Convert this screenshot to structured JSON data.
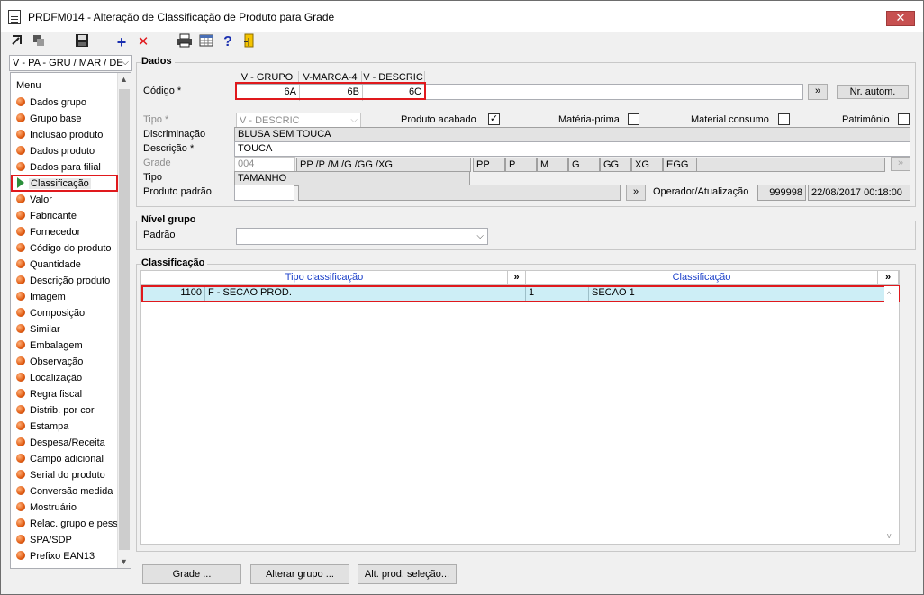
{
  "window": {
    "title": "PRDFM014 - Alteração de Classificação de Produto para Grade",
    "close_icon": "✕"
  },
  "toolbar": {
    "icons": [
      "navigate-icon",
      "copy-icon",
      "save-icon",
      "add-icon",
      "delete-icon",
      "print-icon",
      "grid-icon",
      "help-icon",
      "exit-icon"
    ]
  },
  "sidebar": {
    "combo_value": "V - PA - GRU / MAR / DE",
    "menu_title": "Menu",
    "items": [
      {
        "label": "Dados grupo"
      },
      {
        "label": "Grupo base"
      },
      {
        "label": "Inclusão produto"
      },
      {
        "label": "Dados produto"
      },
      {
        "label": "Dados para filial"
      },
      {
        "label": "Classificação",
        "selected": true
      },
      {
        "label": "Valor"
      },
      {
        "label": "Fabricante"
      },
      {
        "label": "Fornecedor"
      },
      {
        "label": "Código do produto"
      },
      {
        "label": "Quantidade"
      },
      {
        "label": "Descrição produto"
      },
      {
        "label": "Imagem"
      },
      {
        "label": "Composição"
      },
      {
        "label": "Similar"
      },
      {
        "label": "Embalagem"
      },
      {
        "label": "Observação"
      },
      {
        "label": "Localização"
      },
      {
        "label": "Regra fiscal"
      },
      {
        "label": "Distrib. por cor"
      },
      {
        "label": "Estampa"
      },
      {
        "label": "Despesa/Receita"
      },
      {
        "label": "Campo adicional"
      },
      {
        "label": "Serial do produto"
      },
      {
        "label": "Conversão medida"
      },
      {
        "label": "Mostruário"
      },
      {
        "label": "Relac. grupo e pess"
      },
      {
        "label": "SPA/SDP"
      },
      {
        "label": "Prefixo EAN13"
      }
    ]
  },
  "dados": {
    "section_title": "Dados",
    "codigo_label": "Código *",
    "codigo_columns": [
      "V - GRUPO",
      "V-MARCA-4",
      "V - DESCRIC"
    ],
    "codigo_values": [
      "6A",
      "6B",
      "6C"
    ],
    "expand_label": "»",
    "nr_autom_label": "Nr. autom.",
    "tipo_label": "Tipo *",
    "tipo_value": "V - DESCRIC",
    "produto_acabado_label": "Produto acabado",
    "produto_acabado_checked": true,
    "materia_prima_label": "Matéria-prima",
    "material_consumo_label": "Material consumo",
    "patrimonio_label": "Patrimônio",
    "discriminacao_label": "Discriminação",
    "discriminacao_value": "BLUSA SEM TOUCA",
    "descricao_label": "Descrição *",
    "descricao_value": "TOUCA",
    "grade_label": "Grade",
    "grade_code": "004",
    "grade_summary": "PP /P /M /G /GG /XG",
    "grade_sizes": [
      "PP",
      "P",
      "M",
      "G",
      "GG",
      "XG",
      "EGG"
    ],
    "tipo2_label": "Tipo",
    "tipo2_value": "TAMANHO",
    "produto_padrao_label": "Produto padrão",
    "operador_label": "Operador/Atualização",
    "operador_value": "999998",
    "atualizacao_value": "22/08/2017 00:18:00"
  },
  "nivel_grupo": {
    "section_title": "Nível grupo",
    "padrao_label": "Padrão",
    "padrao_value": ""
  },
  "classificacao": {
    "section_title": "Classificação",
    "headers": [
      "Tipo classificação",
      "Classificação"
    ],
    "expand_label": "»",
    "rows": [
      {
        "tipo_code": "1100",
        "tipo_desc": "F - SECAO PROD.",
        "class_code": "1",
        "class_desc": "SECAO 1"
      }
    ]
  },
  "footer": {
    "grade_btn": "Grade ...",
    "alterar_grupo_btn": "Alterar grupo ...",
    "alt_prod_btn": "Alt. prod. seleção..."
  }
}
